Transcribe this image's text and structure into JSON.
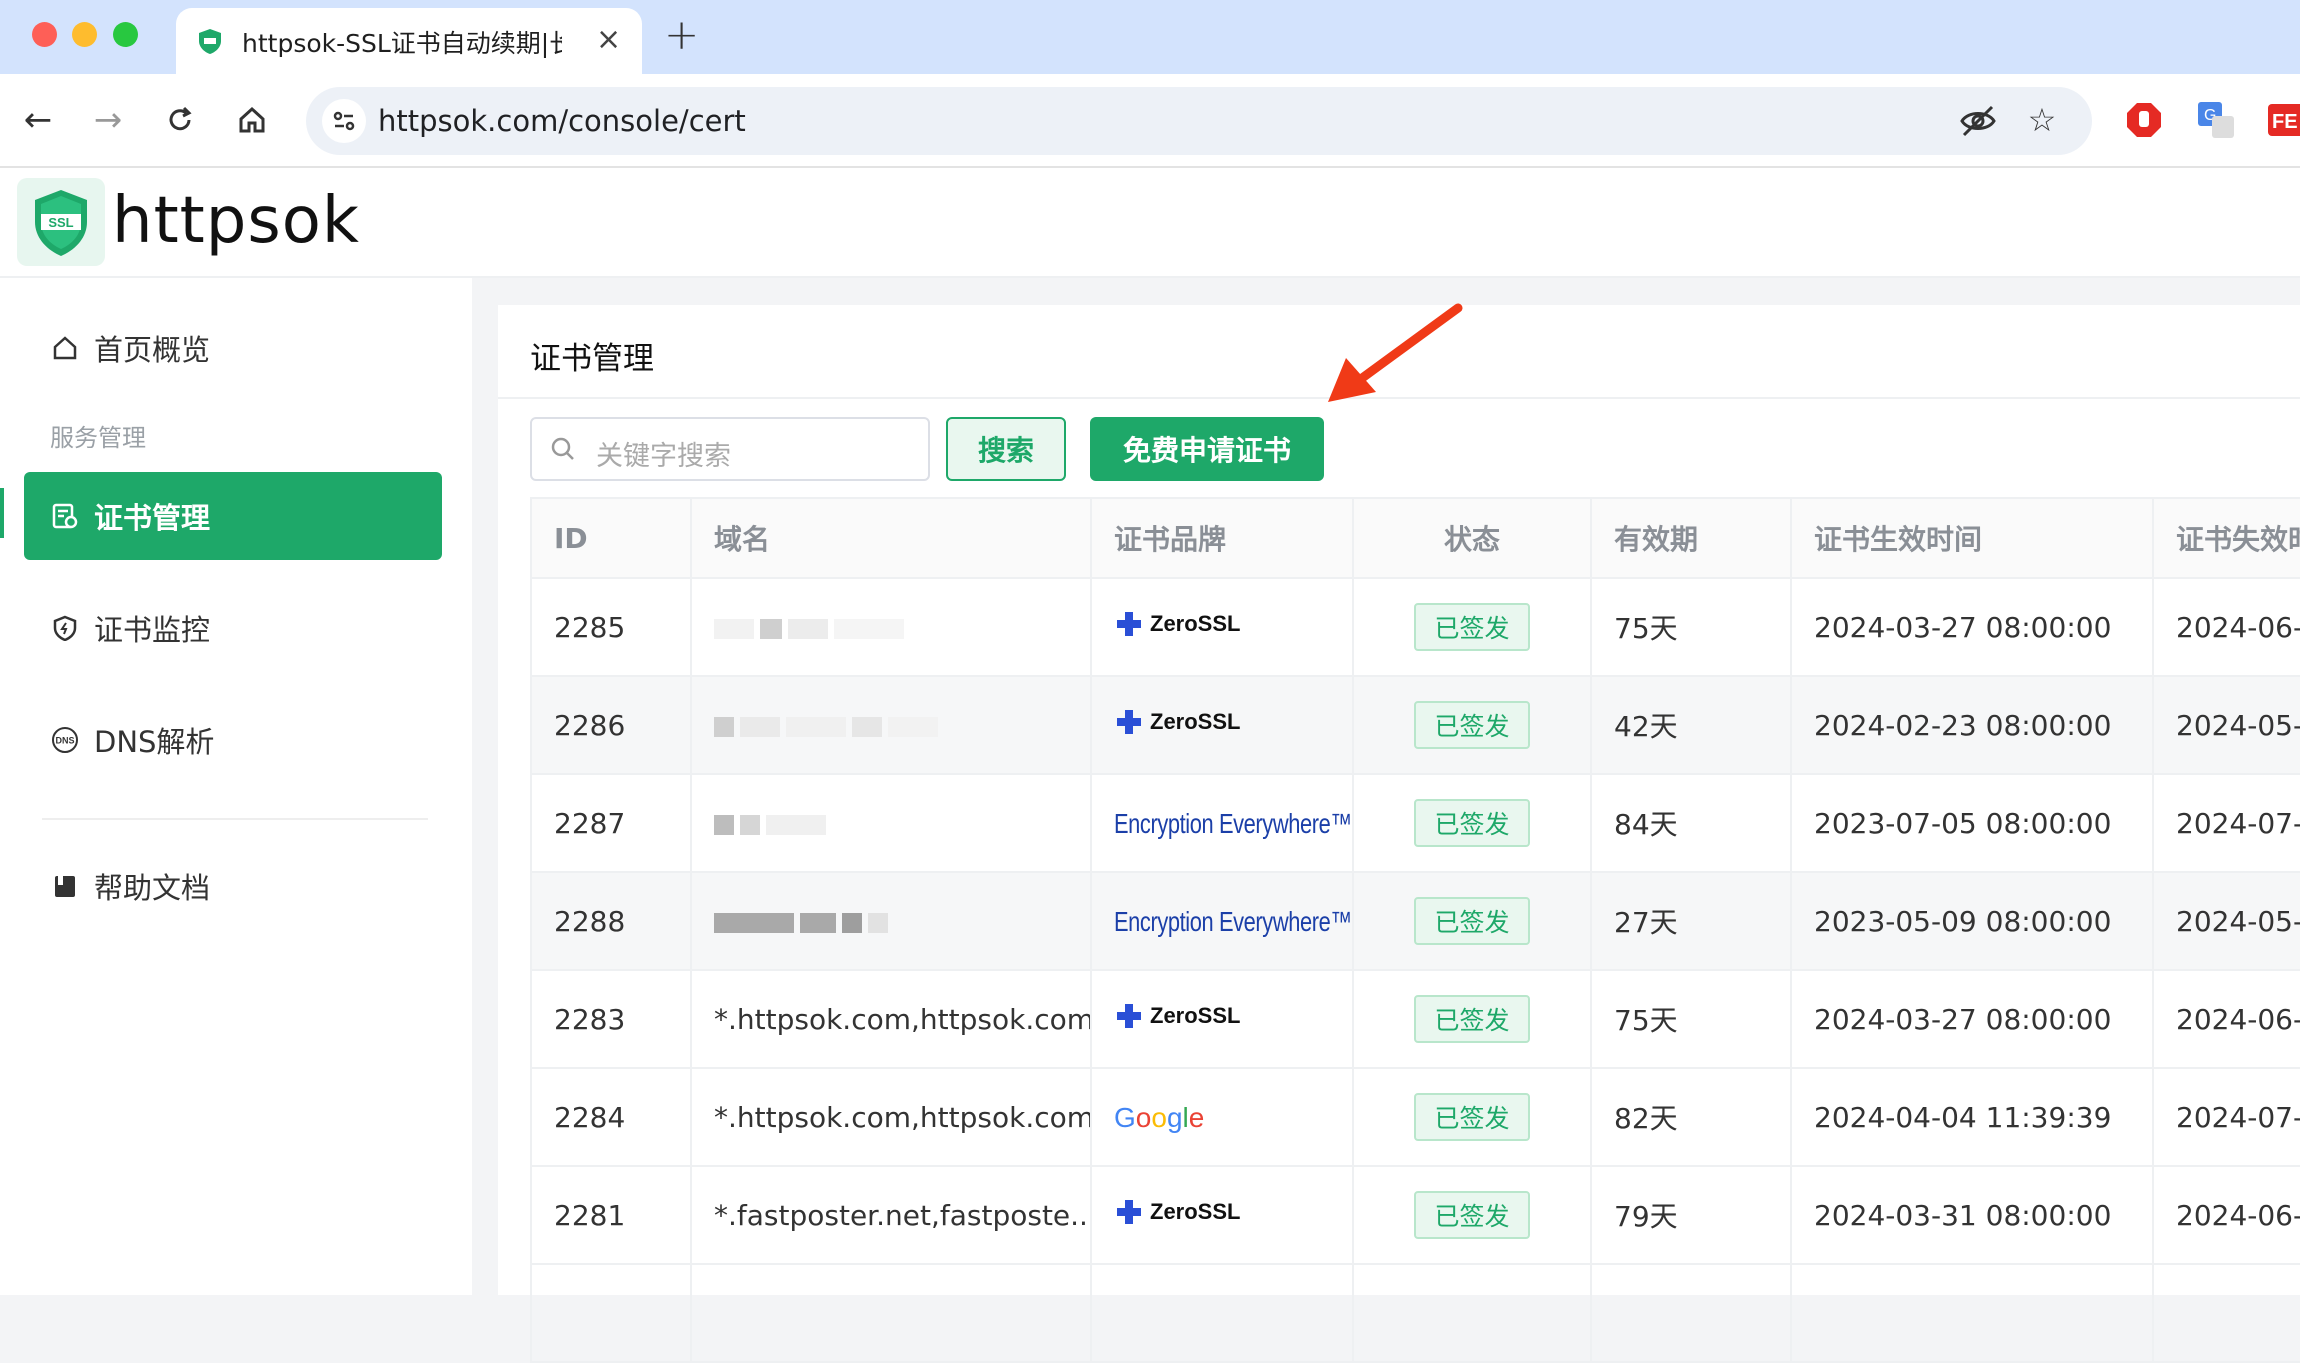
{
  "browser": {
    "tab_title": "httpsok-SSL证书自动续期|长沙",
    "tab_close": "×",
    "new_tab": "+",
    "url": "httpsok.com/console/cert"
  },
  "app": {
    "brand": "httpsok",
    "logo_text": "SSL"
  },
  "sidebar": {
    "group_label": "服务管理",
    "items": [
      {
        "label": "首页概览",
        "icon": "home-icon"
      },
      {
        "label": "证书管理",
        "icon": "cert-icon"
      },
      {
        "label": "证书监控",
        "icon": "shield-icon"
      },
      {
        "label": "DNS解析",
        "icon": "dns-icon"
      },
      {
        "label": "帮助文档",
        "icon": "book-icon"
      }
    ]
  },
  "main": {
    "title": "证书管理",
    "search_placeholder": "关键字搜索",
    "search_button": "搜索",
    "apply_button": "免费申请证书"
  },
  "table": {
    "columns": [
      "ID",
      "域名",
      "证书品牌",
      "状态",
      "有效期",
      "证书生效时间",
      "证书失效时"
    ],
    "rows": [
      {
        "id": "2285",
        "domain": "",
        "brand": "ZeroSSL",
        "status": "已签发",
        "validity": "75天",
        "start": "2024-03-27 08:00:00",
        "end": "2024-06-"
      },
      {
        "id": "2286",
        "domain": "",
        "brand": "ZeroSSL",
        "status": "已签发",
        "validity": "42天",
        "start": "2024-02-23 08:00:00",
        "end": "2024-05-"
      },
      {
        "id": "2287",
        "domain": "",
        "brand": "Encryption Everywhere™",
        "status": "已签发",
        "validity": "84天",
        "start": "2023-07-05 08:00:00",
        "end": "2024-07-"
      },
      {
        "id": "2288",
        "domain": "",
        "brand": "Encryption Everywhere™",
        "status": "已签发",
        "validity": "27天",
        "start": "2023-05-09 08:00:00",
        "end": "2024-05-"
      },
      {
        "id": "2283",
        "domain": "*.httpsok.com,httpsok.com",
        "brand": "ZeroSSL",
        "status": "已签发",
        "validity": "75天",
        "start": "2024-03-27 08:00:00",
        "end": "2024-06-"
      },
      {
        "id": "2284",
        "domain": "*.httpsok.com,httpsok.com",
        "brand": "Google",
        "status": "已签发",
        "validity": "82天",
        "start": "2024-04-04 11:39:39",
        "end": "2024-07-"
      },
      {
        "id": "2281",
        "domain": "*.fastposter.net,fastposte...",
        "brand": "ZeroSSL",
        "status": "已签发",
        "validity": "79天",
        "start": "2024-03-31 08:00:00",
        "end": "2024-06-"
      }
    ]
  },
  "colors": {
    "accent": "#1ea869",
    "tabbar": "#d3e3fd",
    "arrow": "#f03a17"
  }
}
